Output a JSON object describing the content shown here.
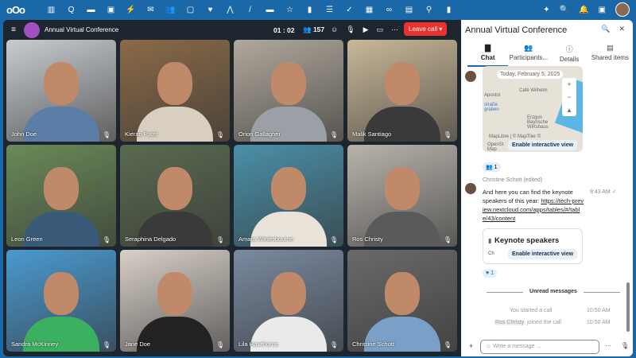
{
  "topbar": {
    "logo": "oOo",
    "apps": [
      "▥",
      "Q",
      "▬",
      "▣",
      "⚡",
      "✉",
      "👥",
      "▢",
      "♥",
      "⋀",
      "/",
      "▬",
      "☆",
      "▮",
      "☰",
      "✓",
      "▦",
      "∞",
      "▤",
      "⚲",
      "▮"
    ],
    "right_icons": [
      "✦",
      "🔍",
      "🔔",
      "▣"
    ]
  },
  "call": {
    "title": "Annual Virtual Conference",
    "timer": "01 : 02",
    "participants": "157",
    "leave_label": "Leave call ▾",
    "tiles": [
      {
        "name": "John Doe",
        "bg": "#c8ccd0",
        "shirt": "#5a7ea8"
      },
      {
        "name": "Kieran Patel",
        "bg": "#8a6a48",
        "shirt": "#d8cfc0"
      },
      {
        "name": "Orion Gallagher",
        "bg": "#b0a89c",
        "shirt": "#9aa0a6"
      },
      {
        "name": "Malik Santiago",
        "bg": "#c8b898",
        "shirt": "#3a3a3a"
      },
      {
        "name": "Leon Green",
        "bg": "#6a8a58",
        "shirt": "#3a5a7a"
      },
      {
        "name": "Seraphina Delgado",
        "bg": "#5a6a50",
        "shirt": "#3a3a3a"
      },
      {
        "name": "Amara Winterbourne",
        "bg": "#4a90a8",
        "shirt": "#e8e2d8"
      },
      {
        "name": "Ros Christy",
        "bg": "#b8b4ac",
        "shirt": "#5a5a5a"
      },
      {
        "name": "Sandra McKinney",
        "bg": "#4a9ad0",
        "shirt": "#3ab060"
      },
      {
        "name": "Jane Doe",
        "bg": "#d8d0c8",
        "shirt": "#222222"
      },
      {
        "name": "Lila Hawthorne",
        "bg": "#7a8aa0",
        "shirt": "#eaeaea"
      },
      {
        "name": "Christine Schott",
        "bg": "#6a6a6a",
        "shirt": "#7aa0c8"
      }
    ]
  },
  "sidebar": {
    "title": "Annual Virtual Conference",
    "tabs": [
      {
        "icon": "▇",
        "label": "Chat"
      },
      {
        "icon": "👥",
        "label": "Participants..."
      },
      {
        "icon": "ⓘ",
        "label": "Details"
      },
      {
        "icon": "▤",
        "label": "Shared items"
      }
    ],
    "map": {
      "date_chip": "Today, February 5, 2025",
      "labels": [
        "Apostol",
        "Café Wilhelm",
        "straße graben",
        "Erzgun Bayrische Wirtshaus"
      ],
      "attribution": "MapLibre | © MapTiler ©",
      "osm": "OpenSt Map",
      "enable": "Enable interactive view"
    },
    "reaction1": "👥 1",
    "message": {
      "author": "Christine Schott (edited)",
      "text": "And here you can find the keynote speakers of this year: ",
      "link": "https://tech-preview.nextcloud.com/apps/tables/#/table/43/content",
      "time": "9:43 AM ✓"
    },
    "card": {
      "title": "Keynote speakers",
      "prefix": "Ch",
      "enable": "Enable interactive view"
    },
    "reaction2": "♥ 1",
    "unread": "Unread messages",
    "sys1": {
      "text": "You started a call",
      "time": "10:50 AM"
    },
    "sys2": {
      "user": "Ros Christy",
      "text": "joined the call",
      "time": "10:50 AM"
    },
    "composer_placeholder": "Write a message ..."
  }
}
